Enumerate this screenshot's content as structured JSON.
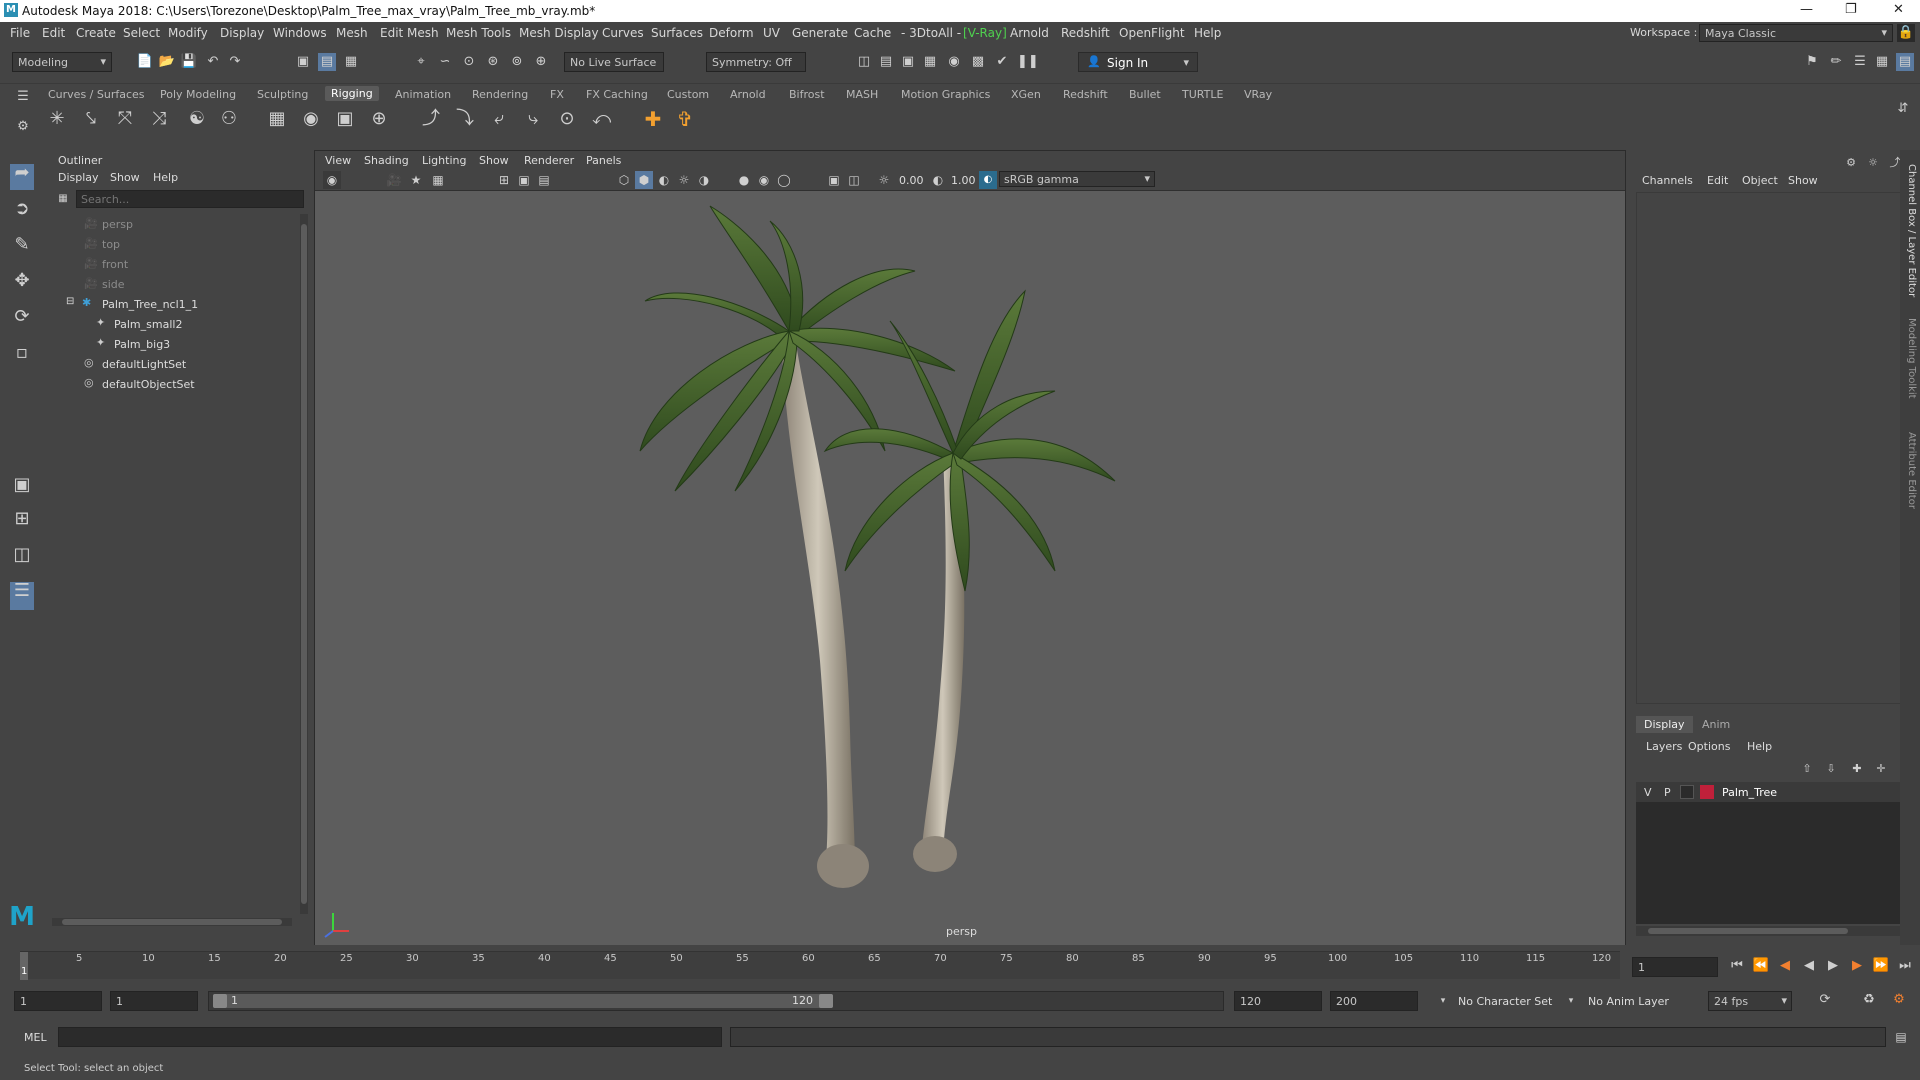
{
  "titlebar": {
    "title": "Autodesk Maya 2018: C:\\Users\\Torezone\\Desktop\\Palm_Tree_max_vray\\Palm_Tree_mb_vray.mb*"
  },
  "menu": [
    "File",
    "Edit",
    "Create",
    "Select",
    "Modify",
    "Display",
    "Windows",
    "Mesh",
    "Edit Mesh",
    "Mesh Tools",
    "Mesh Display",
    "Curves",
    "Surfaces",
    "Deform",
    "UV",
    "Generate",
    "Cache",
    "- 3DtoAll -",
    "V-Ray",
    "Arnold",
    "Redshift",
    "OpenFlight",
    "Help"
  ],
  "workspace": {
    "label": "Workspace :",
    "value": "Maya Classic"
  },
  "statusline": {
    "mode": "Modeling",
    "live_surface": "No Live Surface",
    "symmetry": "Symmetry: Off",
    "sign_in": "Sign In"
  },
  "shelf_tabs": [
    "Curves / Surfaces",
    "Poly Modeling",
    "Sculpting",
    "Rigging",
    "Animation",
    "Rendering",
    "FX",
    "FX Caching",
    "Custom",
    "Arnold",
    "Bifrost",
    "MASH",
    "Motion Graphics",
    "XGen",
    "Redshift",
    "Bullet",
    "TURTLE",
    "VRay"
  ],
  "shelf_active": "Rigging",
  "outliner": {
    "title": "Outliner",
    "menu": [
      "Display",
      "Show",
      "Help"
    ],
    "search_placeholder": "Search...",
    "items": [
      {
        "label": "persp",
        "dim": true
      },
      {
        "label": "top",
        "dim": true
      },
      {
        "label": "front",
        "dim": true
      },
      {
        "label": "side",
        "dim": true
      },
      {
        "label": "Palm_Tree_ncl1_1",
        "dim": false
      },
      {
        "label": "Palm_small2",
        "dim": false
      },
      {
        "label": "Palm_big3",
        "dim": false
      },
      {
        "label": "defaultLightSet",
        "dim": false
      },
      {
        "label": "defaultObjectSet",
        "dim": false
      }
    ]
  },
  "viewport": {
    "menu": [
      "View",
      "Shading",
      "Lighting",
      "Show",
      "Renderer",
      "Panels"
    ],
    "exposure": "0.00",
    "gamma": "1.00",
    "colorspace": "sRGB gamma",
    "camera_label": "persp"
  },
  "channels": {
    "menu": [
      "Channels",
      "Edit",
      "Object",
      "Show"
    ],
    "side_tabs": [
      "Channel Box / Layer Editor",
      "Modeling Toolkit",
      "Attribute Editor"
    ],
    "layer_tabs": [
      "Display",
      "Anim"
    ],
    "layer_menu": [
      "Layers",
      "Options",
      "Help"
    ],
    "layer": {
      "v": "V",
      "p": "P",
      "name": "Palm_Tree",
      "color": "#c0203a"
    }
  },
  "timeline": {
    "ticks": [
      "5",
      "10",
      "15",
      "20",
      "25",
      "30",
      "35",
      "40",
      "45",
      "50",
      "55",
      "60",
      "65",
      "70",
      "75",
      "80",
      "85",
      "90",
      "95",
      "100",
      "105",
      "110",
      "115",
      "120"
    ],
    "current": "1",
    "current_frame_field": "1"
  },
  "range": {
    "start": "1",
    "playback_start": "1",
    "slider_start": "1",
    "slider_end": "120",
    "playback_end": "120",
    "end": "200",
    "character_set": "No Character Set",
    "anim_layer": "No Anim Layer",
    "fps": "24 fps"
  },
  "cmdline": {
    "label": "MEL"
  },
  "helpline": {
    "text": "Select Tool: select an object"
  }
}
